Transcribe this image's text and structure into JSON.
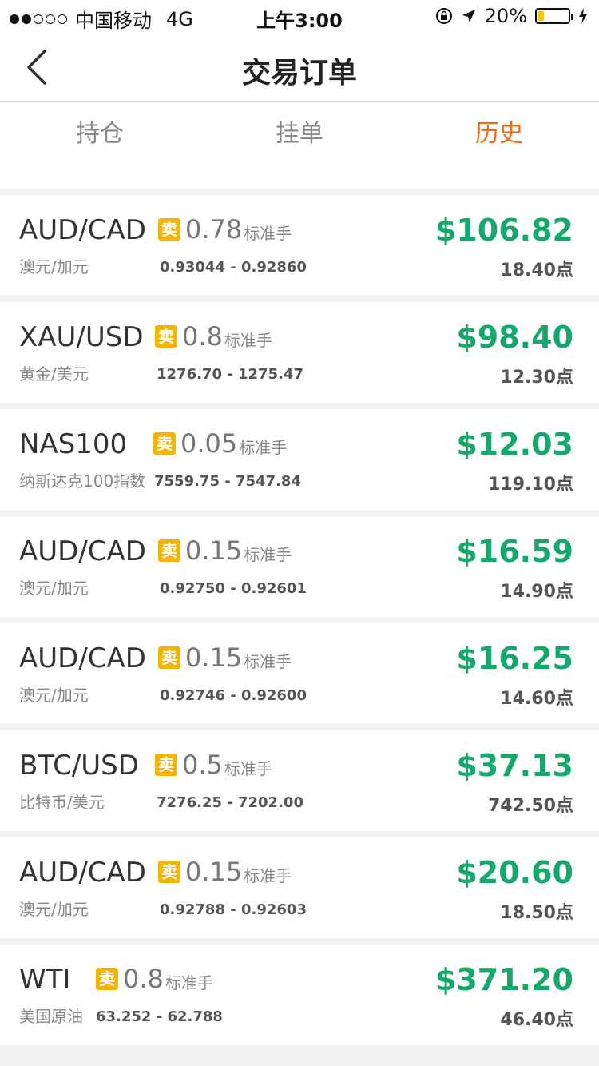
{
  "status_bar": {
    "carrier": "中国移动",
    "network": "4G",
    "time": "上午3:00",
    "battery": "20%",
    "battery_level": 0.2,
    "signal_strength": 2
  },
  "navbar": {
    "title": "交易订单"
  },
  "tabs": [
    {
      "label": "持仓",
      "active": false
    },
    {
      "label": "挂单",
      "active": false
    },
    {
      "label": "历史",
      "active": true
    }
  ],
  "colors": {
    "accent": "#f26b0f",
    "profit": "#14a86a",
    "badge": "#f5b400"
  },
  "orders": [
    {
      "symbol": "AUD/CAD",
      "name": "澳元/加元",
      "side": "卖",
      "lots": "0.78",
      "unit": "标准手",
      "range": "0.93044 - 0.92860",
      "profit": "$106.82",
      "points": "18.40点"
    },
    {
      "symbol": "XAU/USD",
      "name": "黄金/美元",
      "side": "卖",
      "lots": "0.8",
      "unit": "标准手",
      "range": "1276.70 - 1275.47",
      "profit": "$98.40",
      "points": "12.30点"
    },
    {
      "symbol": "NAS100",
      "name": "纳斯达克100指数",
      "side": "卖",
      "lots": "0.05",
      "unit": "标准手",
      "range": "7559.75 - 7547.84",
      "profit": "$12.03",
      "points": "119.10点"
    },
    {
      "symbol": "AUD/CAD",
      "name": "澳元/加元",
      "side": "卖",
      "lots": "0.15",
      "unit": "标准手",
      "range": "0.92750 - 0.92601",
      "profit": "$16.59",
      "points": "14.90点"
    },
    {
      "symbol": "AUD/CAD",
      "name": "澳元/加元",
      "side": "卖",
      "lots": "0.15",
      "unit": "标准手",
      "range": "0.92746 - 0.92600",
      "profit": "$16.25",
      "points": "14.60点"
    },
    {
      "symbol": "BTC/USD",
      "name": "比特币/美元",
      "side": "卖",
      "lots": "0.5",
      "unit": "标准手",
      "range": "7276.25 - 7202.00",
      "profit": "$37.13",
      "points": "742.50点"
    },
    {
      "symbol": "AUD/CAD",
      "name": "澳元/加元",
      "side": "卖",
      "lots": "0.15",
      "unit": "标准手",
      "range": "0.92788 - 0.92603",
      "profit": "$20.60",
      "points": "18.50点"
    },
    {
      "symbol": "WTI",
      "name": "美国原油",
      "side": "卖",
      "lots": "0.8",
      "unit": "标准手",
      "range": "63.252 - 62.788",
      "profit": "$371.20",
      "points": "46.40点"
    }
  ]
}
